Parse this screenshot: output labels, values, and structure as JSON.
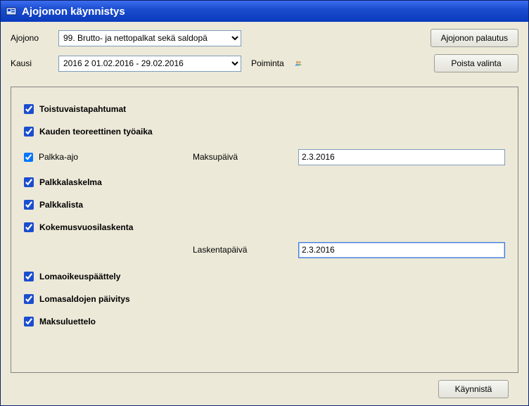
{
  "window": {
    "title": "Ajojonon käynnistys"
  },
  "form": {
    "ajojono_label": "Ajojono",
    "ajojono_value": "99. Brutto- ja nettopalkat sekä saldopä",
    "kausi_label": "Kausi",
    "kausi_value": "2016 2     01.02.2016 - 29.02.2016",
    "poiminta_label": "Poiminta"
  },
  "buttons": {
    "restore": "Ajojonon palautus",
    "clear_selection": "Poista valinta",
    "run": "Käynnistä"
  },
  "options": {
    "toistuvaistapahtumat": {
      "label": "Toistuvaistapahtumat",
      "checked": true
    },
    "kauden_teoreettinen": {
      "label": "Kauden teoreettinen työaika",
      "checked": true
    },
    "palkka_ajo": {
      "label": "Palkka-ajo",
      "checked": true
    },
    "maksupaiva_label": "Maksupäivä",
    "maksupaiva_value": "2.3.2016",
    "palkkalaskelma": {
      "label": "Palkkalaskelma",
      "checked": true
    },
    "palkkalista": {
      "label": "Palkkalista",
      "checked": true
    },
    "kokemusvuosilaskenta": {
      "label": "Kokemusvuosilaskenta",
      "checked": true
    },
    "laskentapaiva_label": "Laskentapäivä",
    "laskentapaiva_value": "2.3.2016",
    "lomaoikeuspaattely": {
      "label": "Lomaoikeuspäättely",
      "checked": true
    },
    "lomasaldojen_paivitys": {
      "label": "Lomasaldojen päivitys",
      "checked": true
    },
    "maksuluettelo": {
      "label": "Maksuluettelo",
      "checked": true
    }
  },
  "icons": {
    "app": "app-icon",
    "poiminta": "people-picker-icon"
  }
}
